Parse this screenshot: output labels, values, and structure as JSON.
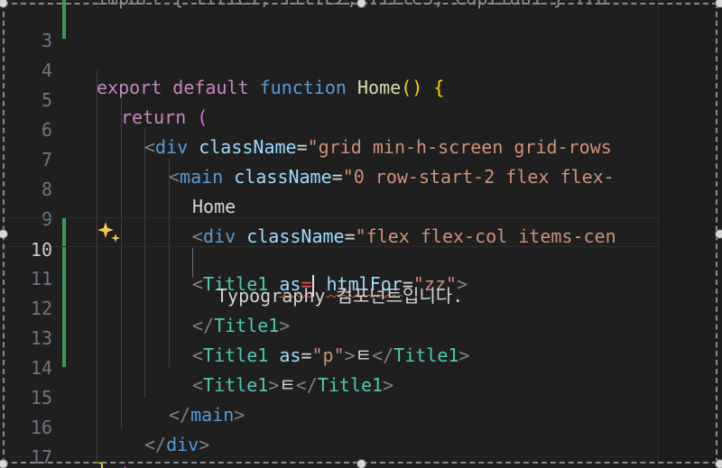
{
  "editor": {
    "top_partial_line": "import { Title1, Title2, Title3, Caption1 } fro",
    "lines": [
      {
        "num": "3",
        "text": ""
      },
      {
        "num": "4",
        "text": "export default function Home() {"
      },
      {
        "num": "5",
        "text": "return ("
      },
      {
        "num": "6",
        "text": "<div className=\"grid min-h-screen grid-rows"
      },
      {
        "num": "7",
        "text": "<main className=\"0 row-start-2 flex flex-"
      },
      {
        "num": "8",
        "text": "Home"
      },
      {
        "num": "9",
        "text": "<div className=\"flex flex-col items-cen"
      },
      {
        "num": "10",
        "text": "<Title1 as= htmlFor=\"zz\">"
      },
      {
        "num": "11",
        "text": "Typography 컴포넌트입니다."
      },
      {
        "num": "12",
        "text": "</Title1>"
      },
      {
        "num": "13",
        "text": "<Title1 as=\"p\">ㅌ</Title1>"
      },
      {
        "num": "14",
        "text": "<Title1>ㅌ</Title1>"
      },
      {
        "num": "15",
        "text": "</main>"
      },
      {
        "num": "16",
        "text": "</div>"
      },
      {
        "num": "17",
        "text": ");"
      }
    ],
    "bottom_partial_line": "}",
    "active_line": "10",
    "icons": {
      "gutter_action": "sparkle-icon"
    },
    "colors": {
      "background": "#1f1f1f",
      "gutter_modified": "#3c9a52",
      "keyword": "#c586c0",
      "tag": "#569cd6",
      "component": "#4ec9b0",
      "attribute": "#9cdcfe",
      "string": "#ce9178",
      "function": "#dcdcaa",
      "error_underline": "#f14c4c"
    }
  }
}
